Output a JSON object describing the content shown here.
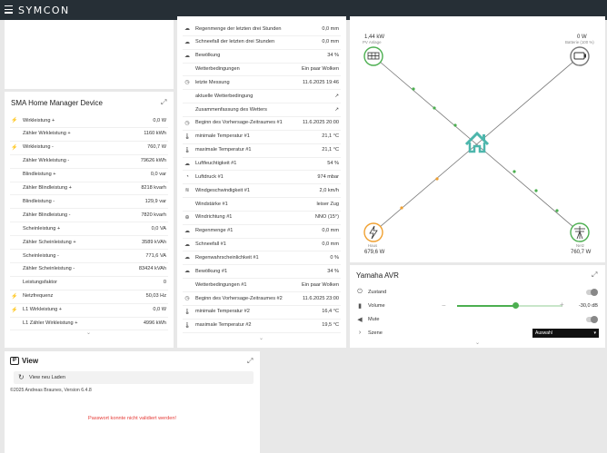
{
  "app": {
    "brand": "SYMCON"
  },
  "sma": {
    "title": "SMA Home Manager Device",
    "rows": [
      {
        "label": "Wirkleistung +",
        "value": "0,0 W",
        "icon": "bolt-icon",
        "indent": false
      },
      {
        "label": "Zähler Wirkleistung +",
        "value": "1160 kWh",
        "icon": "",
        "indent": true
      },
      {
        "label": "Wirkleistung -",
        "value": "760,7 W",
        "icon": "bolt-icon",
        "indent": false
      },
      {
        "label": "Zähler Wirkleistung -",
        "value": "79626 kWh",
        "icon": "",
        "indent": true
      },
      {
        "label": "Blindleistung +",
        "value": "0,0 var",
        "icon": "",
        "indent": true
      },
      {
        "label": "Zähler Blindleistung +",
        "value": "8218 kvarh",
        "icon": "",
        "indent": true
      },
      {
        "label": "Blindleistung -",
        "value": "129,9 var",
        "icon": "",
        "indent": true
      },
      {
        "label": "Zähler Blindleistung -",
        "value": "7820 kvarh",
        "icon": "",
        "indent": true
      },
      {
        "label": "Scheinleistung +",
        "value": "0,0 VA",
        "icon": "",
        "indent": true
      },
      {
        "label": "Zähler Scheinleistung +",
        "value": "3589 kVAh",
        "icon": "",
        "indent": true
      },
      {
        "label": "Scheinleistung -",
        "value": "771,6 VA",
        "icon": "",
        "indent": true
      },
      {
        "label": "Zähler Scheinleistung -",
        "value": "83424 kVAh",
        "icon": "",
        "indent": true
      },
      {
        "label": "Leistungsfaktor",
        "value": "0",
        "icon": "",
        "indent": true
      },
      {
        "label": "Netzfrequenz",
        "value": "50,03 Hz",
        "icon": "bolt-icon",
        "indent": false
      },
      {
        "label": "L1 Wirkleistung +",
        "value": "0,0 W",
        "icon": "bolt-icon",
        "indent": false
      },
      {
        "label": "L1 Zähler Wirkleistung +",
        "value": "4996 kWh",
        "icon": "",
        "indent": true
      }
    ]
  },
  "weather": {
    "rows": [
      {
        "label": "Regenmenge der letzten drei Stunden",
        "value": "0,0 mm",
        "icon": "cloud-icon",
        "indent": false
      },
      {
        "label": "Schneefall der letzten drei Stunden",
        "value": "0,0 mm",
        "icon": "cloud-icon",
        "indent": false
      },
      {
        "label": "Bewölkung",
        "value": "34 %",
        "icon": "cloud-icon",
        "indent": false
      },
      {
        "label": "Wetterbedingungen",
        "value": "Ein paar Wolken",
        "icon": "",
        "indent": true
      },
      {
        "label": "letzte Messung",
        "value": "11.6.2025 19:46",
        "icon": "clock-icon",
        "indent": false
      },
      {
        "label": "aktuelle Wetterbedingung",
        "value": "↗",
        "icon": "",
        "indent": true
      },
      {
        "label": "Zusammenfassung des Wetters",
        "value": "↗",
        "icon": "",
        "indent": true
      },
      {
        "label": "Beginn des Vorhersage-Zeitraumes #1",
        "value": "11.6.2025 20:00",
        "icon": "clock-icon",
        "indent": false
      },
      {
        "label": "minimale Temperatur #1",
        "value": "21,1 °C",
        "icon": "thermometer-icon",
        "indent": false
      },
      {
        "label": "maximale Temperatur #1",
        "value": "21,1 °C",
        "icon": "thermometer-icon",
        "indent": false
      },
      {
        "label": "Luftfeuchtigkeit #1",
        "value": "54 %",
        "icon": "cloud-icon",
        "indent": false
      },
      {
        "label": "Luftdruck #1",
        "value": "974 mbar",
        "icon": "gauge-icon",
        "indent": false
      },
      {
        "label": "Windgeschwindigkeit #1",
        "value": "2,0 km/h",
        "icon": "wind-icon",
        "indent": false
      },
      {
        "label": "Windstärke #1",
        "value": "leiser Zug",
        "icon": "",
        "indent": true
      },
      {
        "label": "Windrichtung #1",
        "value": "NNO (15°)",
        "icon": "compass-icon",
        "indent": false
      },
      {
        "label": "Regenmenge #1",
        "value": "0,0 mm",
        "icon": "cloud-icon",
        "indent": false
      },
      {
        "label": "Schneefall #1",
        "value": "0,0 mm",
        "icon": "cloud-icon",
        "indent": false
      },
      {
        "label": "Regenwahrscheinlichkeit #1",
        "value": "0 %",
        "icon": "cloud-icon",
        "indent": false
      },
      {
        "label": "Bewölkung #1",
        "value": "34 %",
        "icon": "cloud-icon",
        "indent": false
      },
      {
        "label": "Wetterbedingungen #1",
        "value": "Ein paar Wolken",
        "icon": "",
        "indent": true
      },
      {
        "label": "Beginn des Vorhersage-Zeitraumes #2",
        "value": "11.6.2025 23:00",
        "icon": "clock-icon",
        "indent": false
      },
      {
        "label": "minimale Temperatur #2",
        "value": "16,4 °C",
        "icon": "thermometer-icon",
        "indent": false
      },
      {
        "label": "maximale Temperatur #2",
        "value": "19,5 °C",
        "icon": "thermometer-icon",
        "indent": false
      }
    ]
  },
  "energy": {
    "pv": {
      "value": "1,44 kW",
      "label": "PV Anlage"
    },
    "battery": {
      "value": "0 W",
      "label": "Batterie (100 %)"
    },
    "house": {
      "value": "679,6 W",
      "label": "Haus"
    },
    "grid": {
      "value": "760,7 W",
      "label": "Netz"
    },
    "colors": {
      "green": "#4caf50",
      "orange": "#f0a030",
      "gray": "#777777",
      "teal": "#4db6ac"
    }
  },
  "avr": {
    "title": "Yamaha AVR",
    "zustand_label": "Zustand",
    "volume_label": "Volume",
    "volume_value": "-30,0 dB",
    "volume_level": 0.56,
    "mute_label": "Mute",
    "szene_label": "Szene",
    "szene_value": "Auswahl"
  },
  "view": {
    "title": "View",
    "button": "View neu Laden",
    "copyright": "©2025 Andreas Braunes, Version 6.4.8",
    "error": "Passwort konnte nicht validiert werden!",
    "error_color": "#e53935"
  }
}
